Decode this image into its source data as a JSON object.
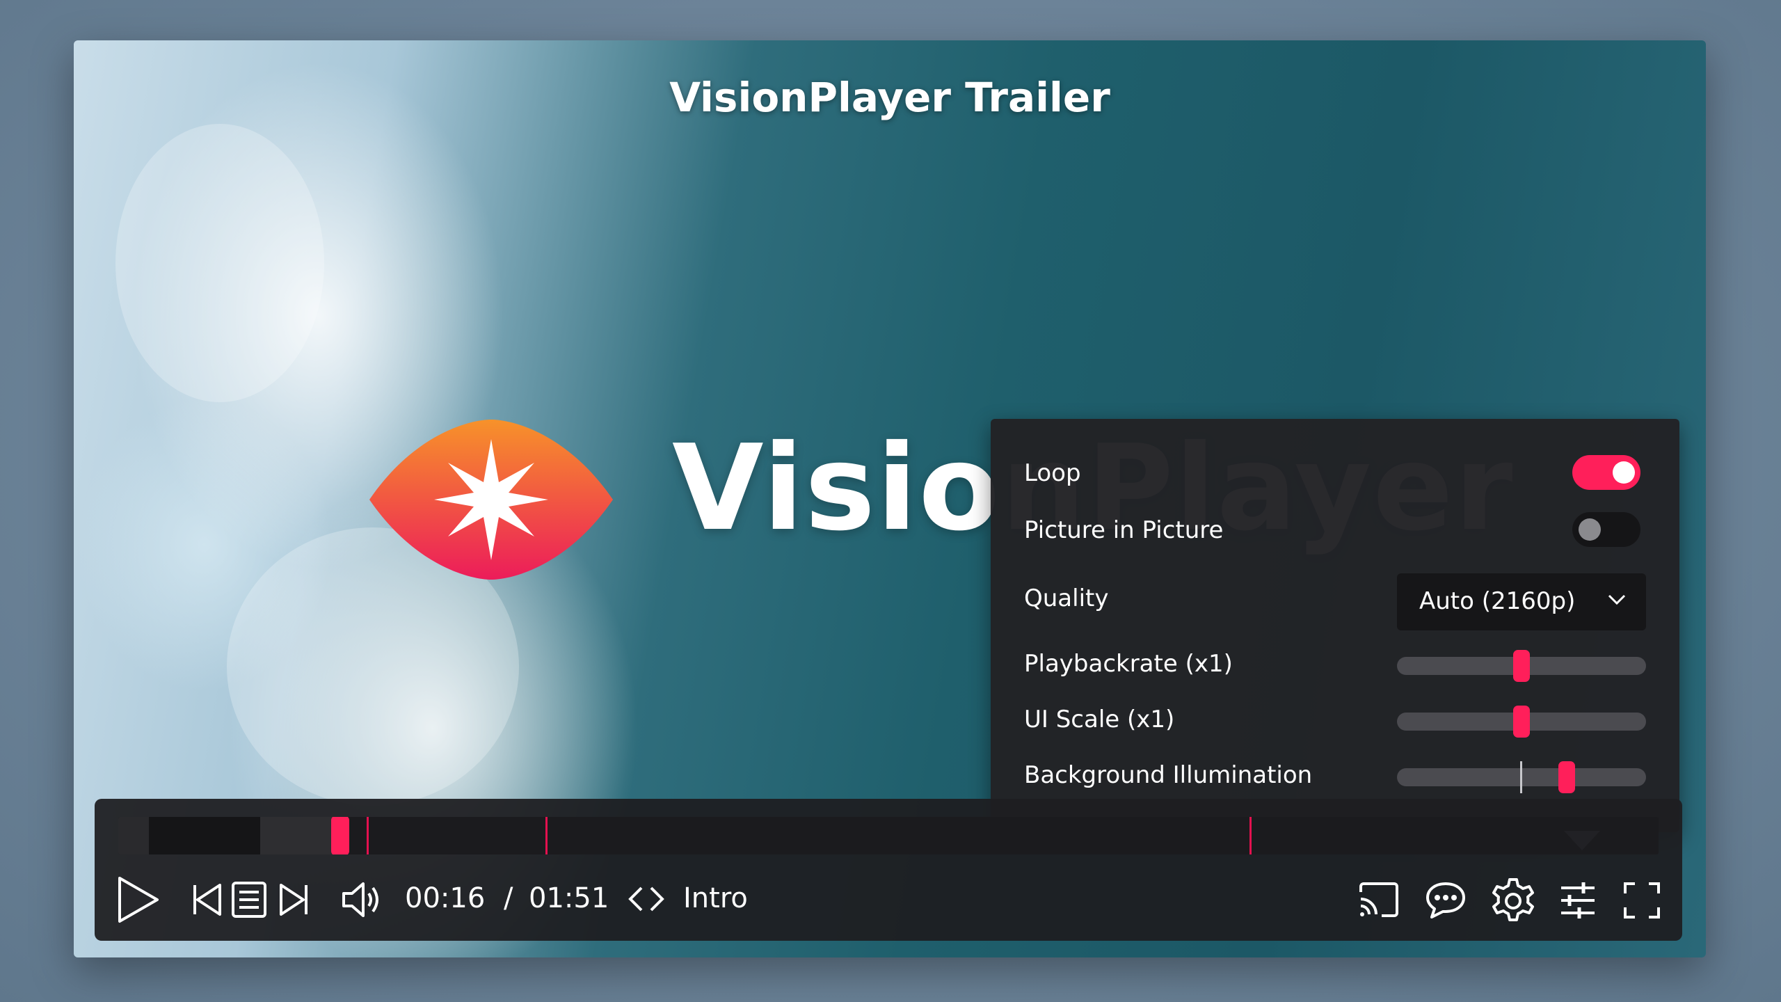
{
  "player": {
    "title": "VisionPlayer Trailer",
    "brand_text": "VisionPlayer"
  },
  "timeline": {
    "buffered_fraction": 0.13,
    "position_fraction": 0.144,
    "chapter_markers": [
      "00:18",
      "00:36",
      "01:07"
    ]
  },
  "controls": {
    "current_time": "00:16",
    "separator": "/",
    "duration": "01:51",
    "chapter_name": "Intro",
    "icons": [
      "play-icon",
      "previous-chapter-icon",
      "chapters-list-icon",
      "next-chapter-icon",
      "volume-icon",
      "chapter-nav-icon",
      "cast-icon",
      "subtitles-icon",
      "settings-icon",
      "equalizer-icon",
      "fullscreen-icon"
    ]
  },
  "settings": {
    "loop": {
      "label": "Loop",
      "enabled": true
    },
    "pip": {
      "label": "Picture in Picture",
      "enabled": false
    },
    "quality": {
      "label": "Quality",
      "value": "Auto (2160p)"
    },
    "playbackrate": {
      "label": "Playbackrate (x1)",
      "level": 0.5
    },
    "ui_scale": {
      "label": "UI Scale (x1)",
      "level": 0.5
    },
    "background_illumination": {
      "label": "Background Illumination",
      "level": 0.68
    }
  },
  "colors": {
    "accent": "#ff1f5a",
    "panel": "#222225",
    "logo_gradient_top": "#f7922a",
    "logo_gradient_bottom": "#ec1c5a"
  }
}
